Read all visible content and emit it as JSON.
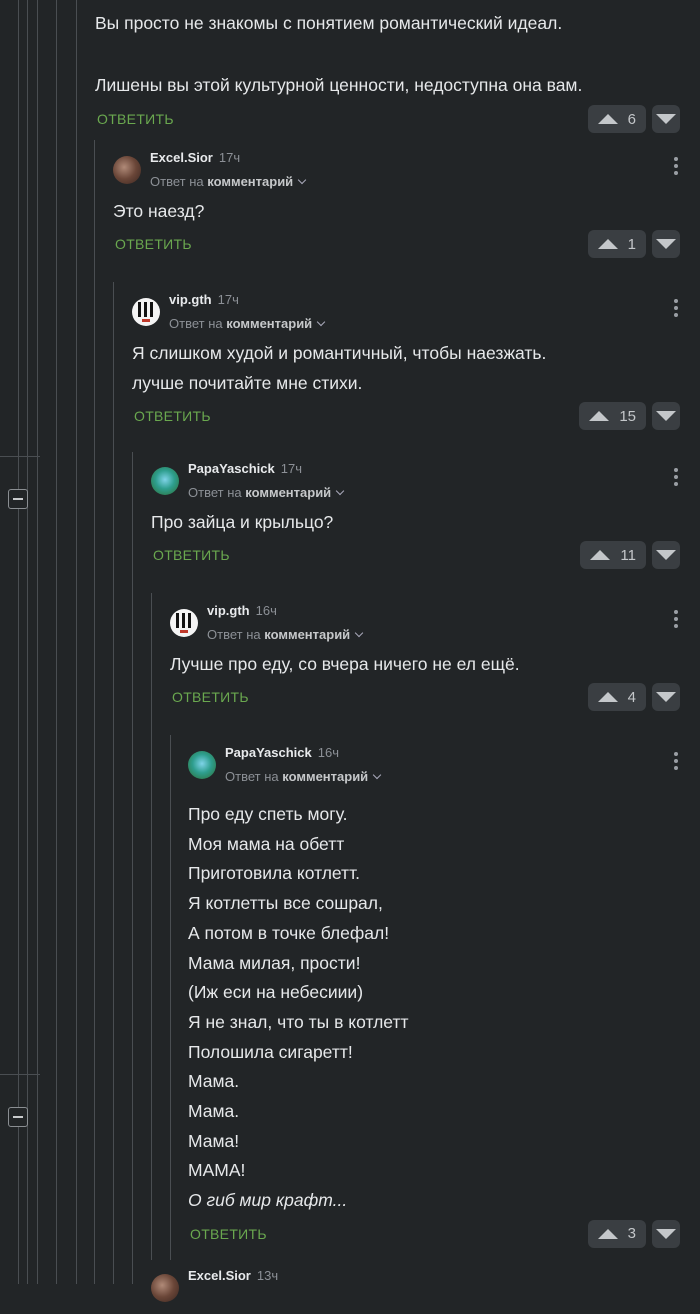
{
  "labels": {
    "reply_button": "ОТВЕТИТЬ",
    "reply_to": "Ответ на",
    "reply_target": "комментарий"
  },
  "comments": [
    {
      "text": "Вы просто не знакомы с понятием романтический идеал.\n\nЛишены вы этой культурной ценности, недоступна она вам.",
      "votes": "6"
    },
    {
      "username": "Excel.Sior",
      "time": "17ч",
      "text": "Это наезд?",
      "votes": "1"
    },
    {
      "username": "vip.gth",
      "time": "17ч",
      "text": "Я слишком худой и романтичный, чтобы наезжать.\nлучше почитайте мне стихи.",
      "votes": "15"
    },
    {
      "username": "PapaYaschick",
      "time": "17ч",
      "text": "Про зайца и крыльцо?",
      "votes": "11"
    },
    {
      "username": "vip.gth",
      "time": "16ч",
      "text": "Лучше про еду, со вчера ничего не ел ещё.",
      "votes": "4"
    },
    {
      "username": "PapaYaschick",
      "time": "16ч",
      "text": "Про еду спеть могу.\nМоя мама на обетт\nПриготовила котлетт.\nЯ котлетты все сошрал,\nА потом в точке блефал!\nМама милая, прости!\n(Иж еси на небесиии)\nЯ не знал, что ты в котлетт\nПолошила сигаретт!\nМама.\nМама.\nМама!\nМАМА!",
      "text_italic": "О гиб мир крафт...",
      "votes": "3"
    },
    {
      "username": "Excel.Sior",
      "time": "13ч"
    }
  ],
  "colors": {
    "background": "#222527",
    "reply_accent": "#6aa84f",
    "thread_line": "#4a4e52"
  },
  "icons": {
    "upvote": "triangle-up",
    "downvote": "triangle-down",
    "more": "vertical-ellipsis",
    "collapse": "minus-box",
    "reply_dropdown": "chevron-down"
  }
}
